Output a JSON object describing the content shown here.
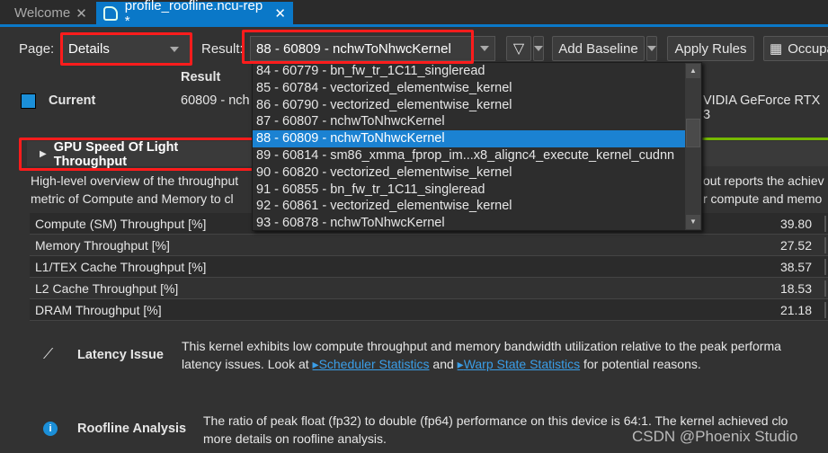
{
  "tabs": [
    {
      "label": "Welcome",
      "close": "✕"
    },
    {
      "label": "profile_roofline.ncu-rep *",
      "close": "✕"
    }
  ],
  "toolbar": {
    "page_label": "Page:",
    "page_value": "Details",
    "result_label": "Result:",
    "result_value": "88 - 60809 - nchwToNhwcKernel",
    "add_baseline": "Add Baseline",
    "apply_rules": "Apply Rules",
    "occupancy": "Occupa"
  },
  "dropdown": {
    "options": [
      "84 - 60779 - bn_fw_tr_1C11_singleread",
      "85 - 60784 - vectorized_elementwise_kernel",
      "86 - 60790 - vectorized_elementwise_kernel",
      "87 - 60807 - nchwToNhwcKernel",
      "88 - 60809 - nchwToNhwcKernel",
      "89 - 60814 - sm86_xmma_fprop_im...x8_alignc4_execute_kernel_cudnn",
      "90 - 60820 - vectorized_elementwise_kernel",
      "91 - 60855 - bn_fw_tr_1C11_singleread",
      "92 - 60861 - vectorized_elementwise_kernel",
      "93 - 60878 - nchwToNhwcKernel"
    ],
    "selected_index": 4
  },
  "results": {
    "header": "Result",
    "current_label": "Current",
    "current_value": "60809 - nch",
    "device": "VIDIA GeForce RTX 3",
    "current_color": "#1b8fd8"
  },
  "section": {
    "title": "GPU Speed Of Light Throughput",
    "desc1_left": "High-level overview of the throughput",
    "desc1_right": "out reports the achiev",
    "desc2_left": "metric of Compute and Memory to cl",
    "desc2_right": "r compute and memo"
  },
  "metrics": [
    {
      "name": "Compute (SM) Throughput [%]",
      "value": "39.80"
    },
    {
      "name": "Memory Throughput [%]",
      "value": "27.52"
    },
    {
      "name": "L1/TEX Cache Throughput [%]",
      "value": "38.57"
    },
    {
      "name": "L2 Cache Throughput [%]",
      "value": "18.53"
    },
    {
      "name": "DRAM Throughput [%]",
      "value": "21.18"
    }
  ],
  "latency": {
    "title": "Latency Issue",
    "line1": "This kernel exhibits low compute throughput and memory bandwidth utilization relative to the peak performa",
    "line2_a": "latency issues. Look at ",
    "link1": "Scheduler Statistics",
    "line2_b": " and ",
    "link2": "Warp State Statistics",
    "line2_c": " for potential reasons."
  },
  "roofline": {
    "title": "Roofline Analysis",
    "line1": "The ratio of peak float (fp32) to double (fp64) performance on this device is 64:1. The kernel achieved clo",
    "line2": "more details on roofline analysis."
  },
  "watermark": "CSDN @Phoenix Studio",
  "colors": {
    "accent": "#0a78c8",
    "highlight": "#ff1c1c",
    "section_line": "#76b900"
  }
}
